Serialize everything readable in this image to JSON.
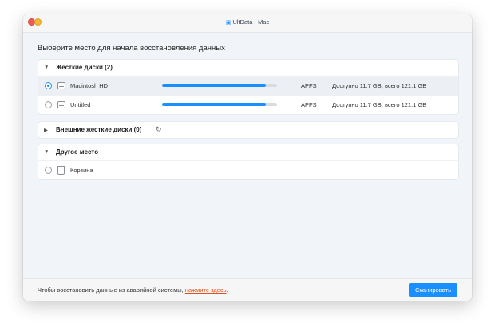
{
  "window": {
    "title": "UltData - Mac",
    "title_icon": "▣"
  },
  "heading": "Выберите место для начала восстановления данных",
  "sections": {
    "hard_disks": {
      "caret": "▼",
      "title": "Жесткие диски (2)",
      "disks": [
        {
          "name": "Macintosh HD",
          "fs": "APFS",
          "space": "Доступно 11.7 GB, всего 121.1 GB",
          "used_fraction": 0.9,
          "selected": true
        },
        {
          "name": "Untitled",
          "fs": "APFS",
          "space": "Доступно 11.7 GB, всего 121.1 GB",
          "used_fraction": 0.9,
          "selected": false
        }
      ]
    },
    "external_disks": {
      "caret": "▶",
      "title": "Внешние жесткие диски (0)",
      "refresh_icon": "↻"
    },
    "other": {
      "caret": "▼",
      "title": "Другое место",
      "items": [
        {
          "name": "Корзина"
        }
      ]
    }
  },
  "footer": {
    "text": "Чтобы восстановить данные из аварийной системы, ",
    "link": "нажмите здесь",
    "after": ".",
    "scan_button": "Сканировать"
  },
  "colors": {
    "accent": "#1a8fff",
    "link": "#e0501f"
  }
}
